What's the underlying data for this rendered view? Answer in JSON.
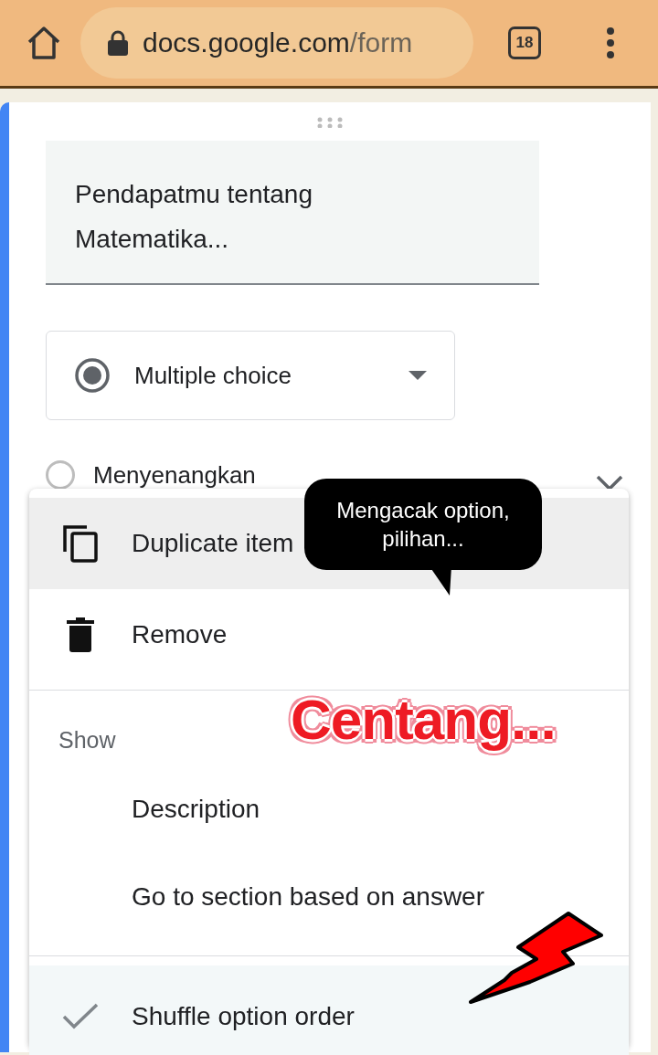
{
  "browser": {
    "url_host": "docs.google.com",
    "url_path": "/form",
    "tab_count": "18"
  },
  "question": {
    "title": "Pendapatmu tentang Matematika...",
    "type": "Multiple choice",
    "first_option": "Menyenangkan",
    "first_option_selected": false
  },
  "menu": {
    "actions": [
      {
        "label": "Duplicate item",
        "selected": true
      },
      {
        "label": "Remove",
        "selected": false
      }
    ],
    "show_header": "Show",
    "toggles": [
      {
        "label": "Description",
        "checked": false
      },
      {
        "label": "Go to section based on answer",
        "checked": false
      }
    ],
    "options": [
      {
        "label": "Shuffle option order",
        "checked": true
      }
    ]
  },
  "annotations": {
    "tooltip": "Mengacak option, pilihan...",
    "callout": "Centang..."
  }
}
